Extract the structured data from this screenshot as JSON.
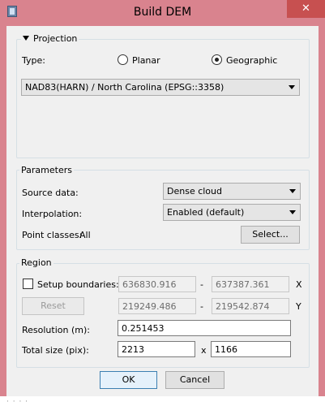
{
  "window": {
    "title": "Build DEM",
    "close_glyph": "✕"
  },
  "projection": {
    "title": "Projection",
    "type_label": "Type:",
    "planar_label": "Planar",
    "geographic_label": "Geographic",
    "selected": "Geographic",
    "crs_value": "NAD83(HARN) / North Carolina (EPSG::3358)"
  },
  "parameters": {
    "title": "Parameters",
    "source_label": "Source data:",
    "source_value": "Dense cloud",
    "interp_label": "Interpolation:",
    "interp_value": "Enabled (default)",
    "classes_label": "Point classes:",
    "classes_value": "All",
    "select_button": "Select..."
  },
  "region": {
    "title": "Region",
    "setup_label": "Setup boundaries:",
    "setup_checked": false,
    "x_min": "636830.916",
    "x_max": "637387.361",
    "x_axis": "X",
    "y_min": "219249.486",
    "y_max": "219542.874",
    "y_axis": "Y",
    "dash": "-",
    "reset_button": "Reset",
    "resolution_label": "Resolution (m):",
    "resolution_value": "0.251453",
    "size_label": "Total size (pix):",
    "size_width": "2213",
    "size_sep": "x",
    "size_height": "1166"
  },
  "actions": {
    "ok": "OK",
    "cancel": "Cancel"
  },
  "colors": {
    "frame": "#d9838e",
    "close_button": "#c75050",
    "dialog_bg": "#f0f0f0"
  }
}
